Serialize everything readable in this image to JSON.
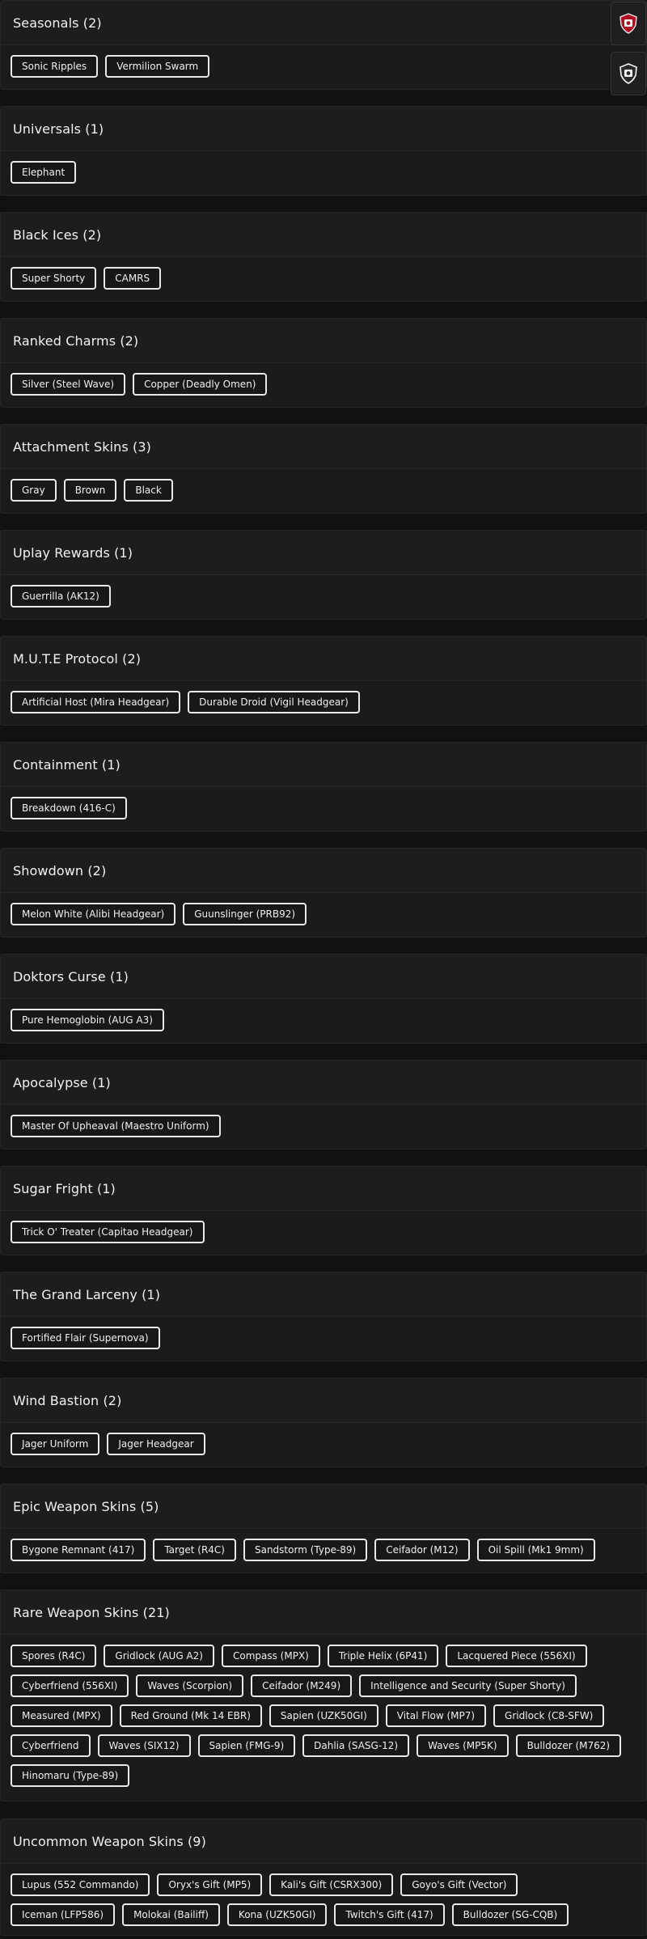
{
  "sections": [
    {
      "title": "Seasonals (2)",
      "items": [
        "Sonic Ripples",
        "Vermilion Swarm"
      ]
    },
    {
      "title": "Universals (1)",
      "items": [
        "Elephant"
      ]
    },
    {
      "title": "Black Ices (2)",
      "items": [
        "Super Shorty",
        "CAMRS"
      ]
    },
    {
      "title": "Ranked Charms (2)",
      "items": [
        "Silver (Steel Wave)",
        "Copper (Deadly Omen)"
      ]
    },
    {
      "title": "Attachment Skins (3)",
      "items": [
        "Gray",
        "Brown",
        "Black"
      ]
    },
    {
      "title": "Uplay Rewards (1)",
      "items": [
        "Guerrilla (AK12)"
      ]
    },
    {
      "title": "M.U.T.E Protocol (2)",
      "items": [
        "Artificial Host (Mira Headgear)",
        "Durable Droid (Vigil Headgear)"
      ]
    },
    {
      "title": "Containment (1)",
      "items": [
        "Breakdown (416-C)"
      ]
    },
    {
      "title": "Showdown (2)",
      "items": [
        "Melon White (Alibi Headgear)",
        "Guunslinger (PRB92)"
      ]
    },
    {
      "title": "Doktors Curse (1)",
      "items": [
        "Pure Hemoglobin (AUG A3)"
      ]
    },
    {
      "title": "Apocalypse (1)",
      "items": [
        "Master Of Upheaval (Maestro Uniform)"
      ]
    },
    {
      "title": "Sugar Fright (1)",
      "items": [
        "Trick O' Treater (Capitao Headgear)"
      ]
    },
    {
      "title": "The Grand Larceny (1)",
      "items": [
        "Fortified Flair (Supernova)"
      ]
    },
    {
      "title": "Wind Bastion (2)",
      "items": [
        "Jager Uniform",
        "Jager Headgear"
      ]
    },
    {
      "title": "Epic Weapon Skins (5)",
      "items": [
        "Bygone Remnant (417)",
        "Target (R4C)",
        "Sandstorm (Type-89)",
        "Ceifador (M12)",
        "Oil Spill (Mk1 9mm)"
      ]
    },
    {
      "title": "Rare Weapon Skins (21)",
      "items": [
        "Spores (R4C)",
        "Gridlock (AUG A2)",
        "Compass (MPX)",
        "Triple Helix (6P41)",
        "Lacquered Piece (556XI)",
        "Cyberfriend (556XI)",
        "Waves (Scorpion)",
        "Ceifador (M249)",
        "Intelligence and Security (Super Shorty)",
        "Measured (MPX)",
        "Red Ground (Mk 14 EBR)",
        "Sapien (UZK50GI)",
        "Vital Flow (MP7)",
        "Gridlock (C8-SFW)",
        "Cyberfriend",
        "Waves (SIX12)",
        "Sapien (FMG-9)",
        "Dahlia (SASG-12)",
        "Waves (MP5K)",
        "Bulldozer (M762)",
        "Hinomaru (Type-89)"
      ]
    },
    {
      "title": "Uncommon Weapon Skins (9)",
      "items": [
        "Lupus (552 Commando)",
        "Oryx's Gift (MP5)",
        "Kali's Gift (CSRX300)",
        "Goyo's Gift (Vector)",
        "Iceman (LFP586)",
        "Molokai (Bailiff)",
        "Kona (UZK50GI)",
        "Twitch's Gift (417)",
        "Bulldozer (SG-CQB)"
      ]
    }
  ],
  "side_buttons": [
    {
      "icon": "red-shield-badge-icon",
      "accent": "#c8102e"
    },
    {
      "icon": "white-shield-badge-icon",
      "accent": "#ffffff"
    }
  ]
}
